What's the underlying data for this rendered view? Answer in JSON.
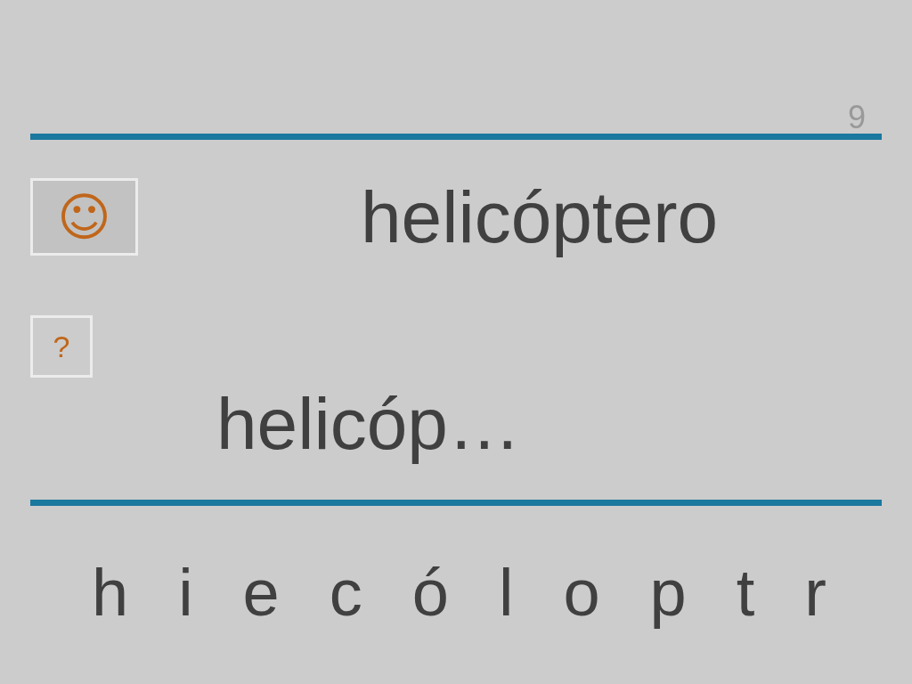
{
  "page_number": "9",
  "reward_button": {
    "label": "☺"
  },
  "word": "helicóptero",
  "help_button": {
    "label": "?"
  },
  "answer": "helicóp…",
  "letters": [
    "h",
    "i",
    "e",
    "c",
    "ó",
    "l",
    "o",
    "p",
    "t",
    "r"
  ]
}
